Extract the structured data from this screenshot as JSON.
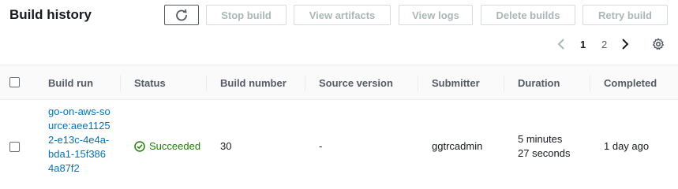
{
  "header": {
    "title": "Build history"
  },
  "toolbar": {
    "stop_label": "Stop build",
    "artifacts_label": "View artifacts",
    "logs_label": "View logs",
    "delete_label": "Delete builds",
    "retry_label": "Retry build"
  },
  "pagination": {
    "page1": "1",
    "page2": "2"
  },
  "table": {
    "columns": [
      "Build run",
      "Status",
      "Build number",
      "Source version",
      "Submitter",
      "Duration",
      "Completed"
    ],
    "rows": [
      {
        "build_run": "go-on-aws-source:aee11252-e13c-4e4a-bda1-15f3864a87f2",
        "status": "Succeeded",
        "build_number": "30",
        "source_version": "-",
        "submitter": "ggtrcadmin",
        "duration_line1": "5 minutes",
        "duration_line2": "27 seconds",
        "completed": "1 day ago"
      }
    ]
  },
  "colors": {
    "link": "#0073bb",
    "success": "#1d8102",
    "disabled": "#aab7b8"
  },
  "icons": [
    "refresh-icon",
    "chevron-left-icon",
    "chevron-right-icon",
    "gear-icon",
    "check-circle-icon"
  ]
}
